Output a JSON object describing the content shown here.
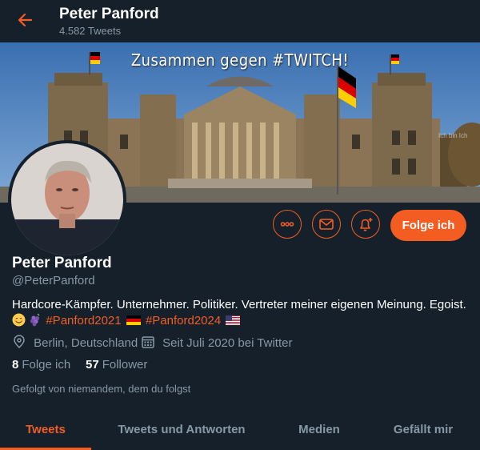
{
  "header": {
    "name": "Peter Panford",
    "tweet_count": "4.582 Tweets"
  },
  "banner": {
    "caption": "Zusammen gegen #TWITCH!",
    "watermark": "Ich bin Ich"
  },
  "actions": {
    "more_icon": "more-horizontal-icon",
    "message_icon": "envelope-icon",
    "notify_icon": "bell-plus-icon",
    "follow_label": "Folge ich"
  },
  "profile": {
    "name": "Peter Panford",
    "handle": "@PeterPanford",
    "bio_line1": "Hardcore-Kämpfer. Unternehmer. Politiker. Vertreter meiner eigenen Meinung. Egoist.",
    "hashtag1": "#Panford2021",
    "hashtag2": "#Panford2024",
    "location": "Berlin, Deutschland",
    "joined": "Seit Juli 2020 bei Twitter",
    "following_count": "8",
    "following_label": "Folge ich",
    "followers_count": "57",
    "followers_label": "Follower",
    "followed_by": "Gefolgt von niemandem, dem du folgst"
  },
  "tabs": [
    {
      "label": "Tweets",
      "active": true
    },
    {
      "label": "Tweets und Antworten",
      "active": false
    },
    {
      "label": "Medien",
      "active": false
    },
    {
      "label": "Gefällt mir",
      "active": false
    }
  ],
  "colors": {
    "background": "#15202b",
    "accent": "#f45d22",
    "secondary_text": "#8899a6"
  }
}
